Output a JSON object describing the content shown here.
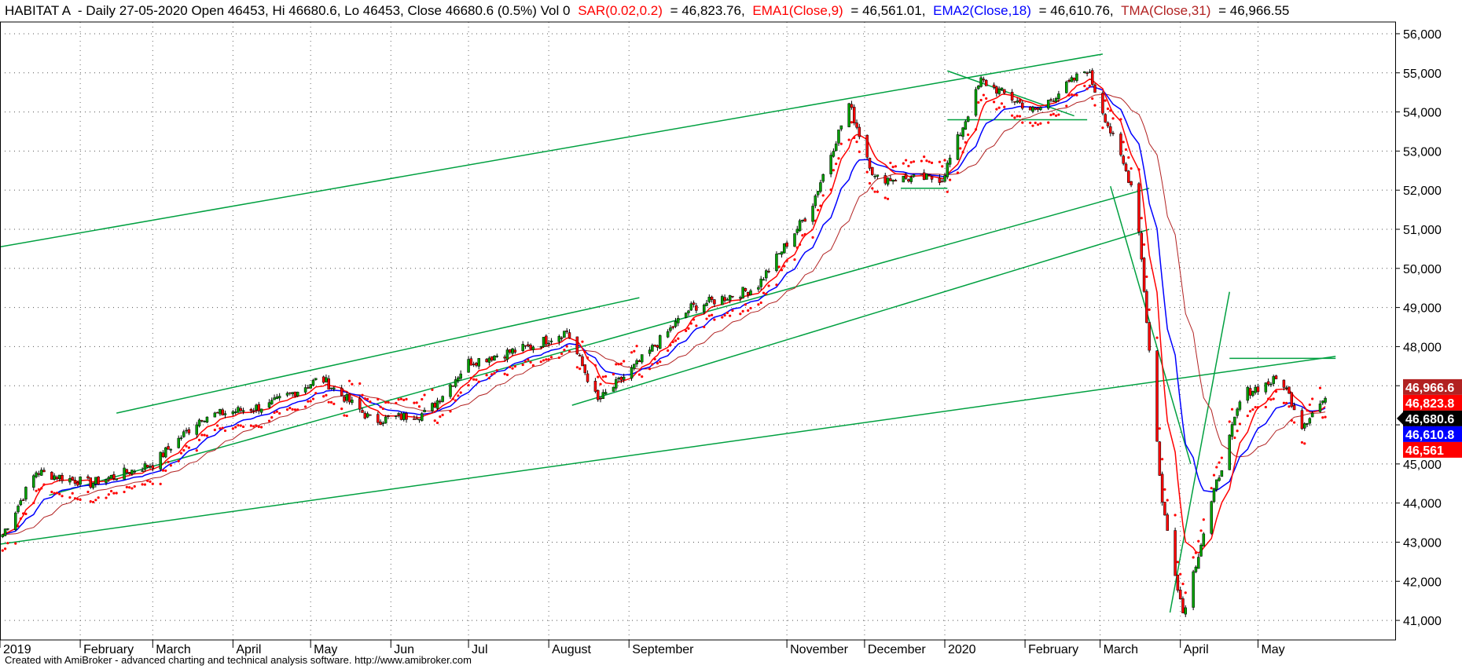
{
  "header": {
    "symbol": "HABITAT A",
    "info": "- Daily 27-05-2020 Open 46453, Hi 46680.6, Lo 46453, Close 46680.6 (0.5%) Vol 0",
    "indicators": [
      {
        "label": "SAR(0.02,0.2)",
        "value": "= 46,823.76,",
        "color": "#ff0000"
      },
      {
        "label": "EMA1(Close,9)",
        "value": "= 46,561.01,",
        "color": "#ff0000"
      },
      {
        "label": "EMA2(Close,18)",
        "value": "= 46,610.76,",
        "color": "#0000ff"
      },
      {
        "label": "TMA(Close,31)",
        "value": "= 46,966.55",
        "color": "#b22222"
      }
    ]
  },
  "footer": "Created with AmiBroker - advanced charting and technical analysis software. http://www.amibroker.com",
  "chart_data": {
    "type": "candlestick",
    "y_axis": {
      "position": "right",
      "min": 40500,
      "max": 56300,
      "ticks": [
        41000,
        42000,
        43000,
        44000,
        45000,
        46000,
        47000,
        48000,
        49000,
        50000,
        51000,
        52000,
        53000,
        54000,
        55000,
        56000
      ],
      "tick_labels": [
        "41,000",
        "42,000",
        "43,000",
        "44,000",
        "45,000",
        "46,000",
        "47,000",
        "48,000",
        "49,000",
        "50,000",
        "51,000",
        "52,000",
        "53,000",
        "54,000",
        "55,000",
        "56,000"
      ],
      "grid": true
    },
    "x_axis": {
      "labels": [
        "2019",
        "February",
        "March",
        "April",
        "May",
        "Jun",
        "Jul",
        "August",
        "September",
        "November",
        "December",
        "2020",
        "February",
        "March",
        "April",
        "May"
      ],
      "grid": "dotted"
    },
    "price_path": [
      {
        "date": "2019-01-02",
        "close": 43200
      },
      {
        "date": "2019-01-15",
        "close": 44800
      },
      {
        "date": "2019-02-05",
        "close": 44500
      },
      {
        "date": "2019-03-01",
        "close": 45000
      },
      {
        "date": "2019-03-20",
        "close": 46200
      },
      {
        "date": "2019-04-15",
        "close": 46500
      },
      {
        "date": "2019-05-05",
        "close": 47200
      },
      {
        "date": "2019-05-25",
        "close": 46100
      },
      {
        "date": "2019-06-15",
        "close": 46300
      },
      {
        "date": "2019-07-01",
        "close": 47600
      },
      {
        "date": "2019-07-25",
        "close": 48000
      },
      {
        "date": "2019-08-08",
        "close": 48400
      },
      {
        "date": "2019-08-20",
        "close": 46600
      },
      {
        "date": "2019-09-05",
        "close": 47600
      },
      {
        "date": "2019-09-25",
        "close": 49000
      },
      {
        "date": "2019-10-20",
        "close": 49500
      },
      {
        "date": "2019-11-10",
        "close": 51500
      },
      {
        "date": "2019-11-25",
        "close": 54200
      },
      {
        "date": "2019-12-05",
        "close": 52300
      },
      {
        "date": "2019-12-31",
        "close": 52300
      },
      {
        "date": "2020-01-15",
        "close": 54800
      },
      {
        "date": "2020-02-05",
        "close": 54000
      },
      {
        "date": "2020-02-25",
        "close": 55100
      },
      {
        "date": "2020-03-05",
        "close": 53500
      },
      {
        "date": "2020-03-15",
        "close": 51800
      },
      {
        "date": "2020-03-25",
        "close": 44000
      },
      {
        "date": "2020-04-02",
        "close": 41200
      },
      {
        "date": "2020-04-15",
        "close": 44500
      },
      {
        "date": "2020-04-25",
        "close": 46800
      },
      {
        "date": "2020-05-10",
        "close": 47200
      },
      {
        "date": "2020-05-18",
        "close": 46000
      },
      {
        "date": "2020-05-27",
        "close": 46680.6
      }
    ],
    "last_values": [
      {
        "name": "TMA(Close,31)",
        "value": 46966.55,
        "label": "46,966.6",
        "color": "#b22222",
        "text_color": "#ffffff"
      },
      {
        "name": "SAR(0.02,0.2)",
        "value": 46823.76,
        "label": "46,823.8",
        "color": "#ff0000",
        "text_color": "#ffffff"
      },
      {
        "name": "Close",
        "value": 46680.6,
        "label": "46,680.6",
        "color": "#000000",
        "text_color": "#ffffff"
      },
      {
        "name": "EMA2(Close,18)",
        "value": 46610.76,
        "label": "46,610.8",
        "color": "#0000ff",
        "text_color": "#ffffff"
      },
      {
        "name": "EMA1(Close,9)",
        "value": 46561.01,
        "label": "46,561",
        "color": "#ff0000",
        "text_color": "#ffffff"
      }
    ],
    "colors": {
      "up_candle": "#00a000",
      "down_candle": "#ff0000",
      "ema9": "#ff0000",
      "ema18": "#0000ff",
      "tma31": "#b22222",
      "sar": "#ff0000",
      "trendlines": "#00a040"
    }
  }
}
